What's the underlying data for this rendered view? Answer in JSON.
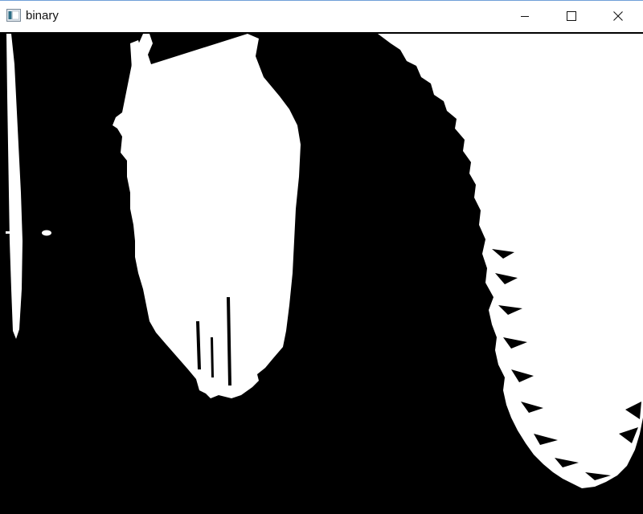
{
  "window": {
    "title": "binary",
    "app_icon": "app-window-icon",
    "controls": {
      "minimize_icon": "minimize-icon",
      "maximize_icon": "maximize-icon",
      "close_icon": "close-icon"
    }
  },
  "image": {
    "kind": "binary-threshold-image",
    "foreground_color": "#ffffff",
    "background_color": "#000000"
  }
}
